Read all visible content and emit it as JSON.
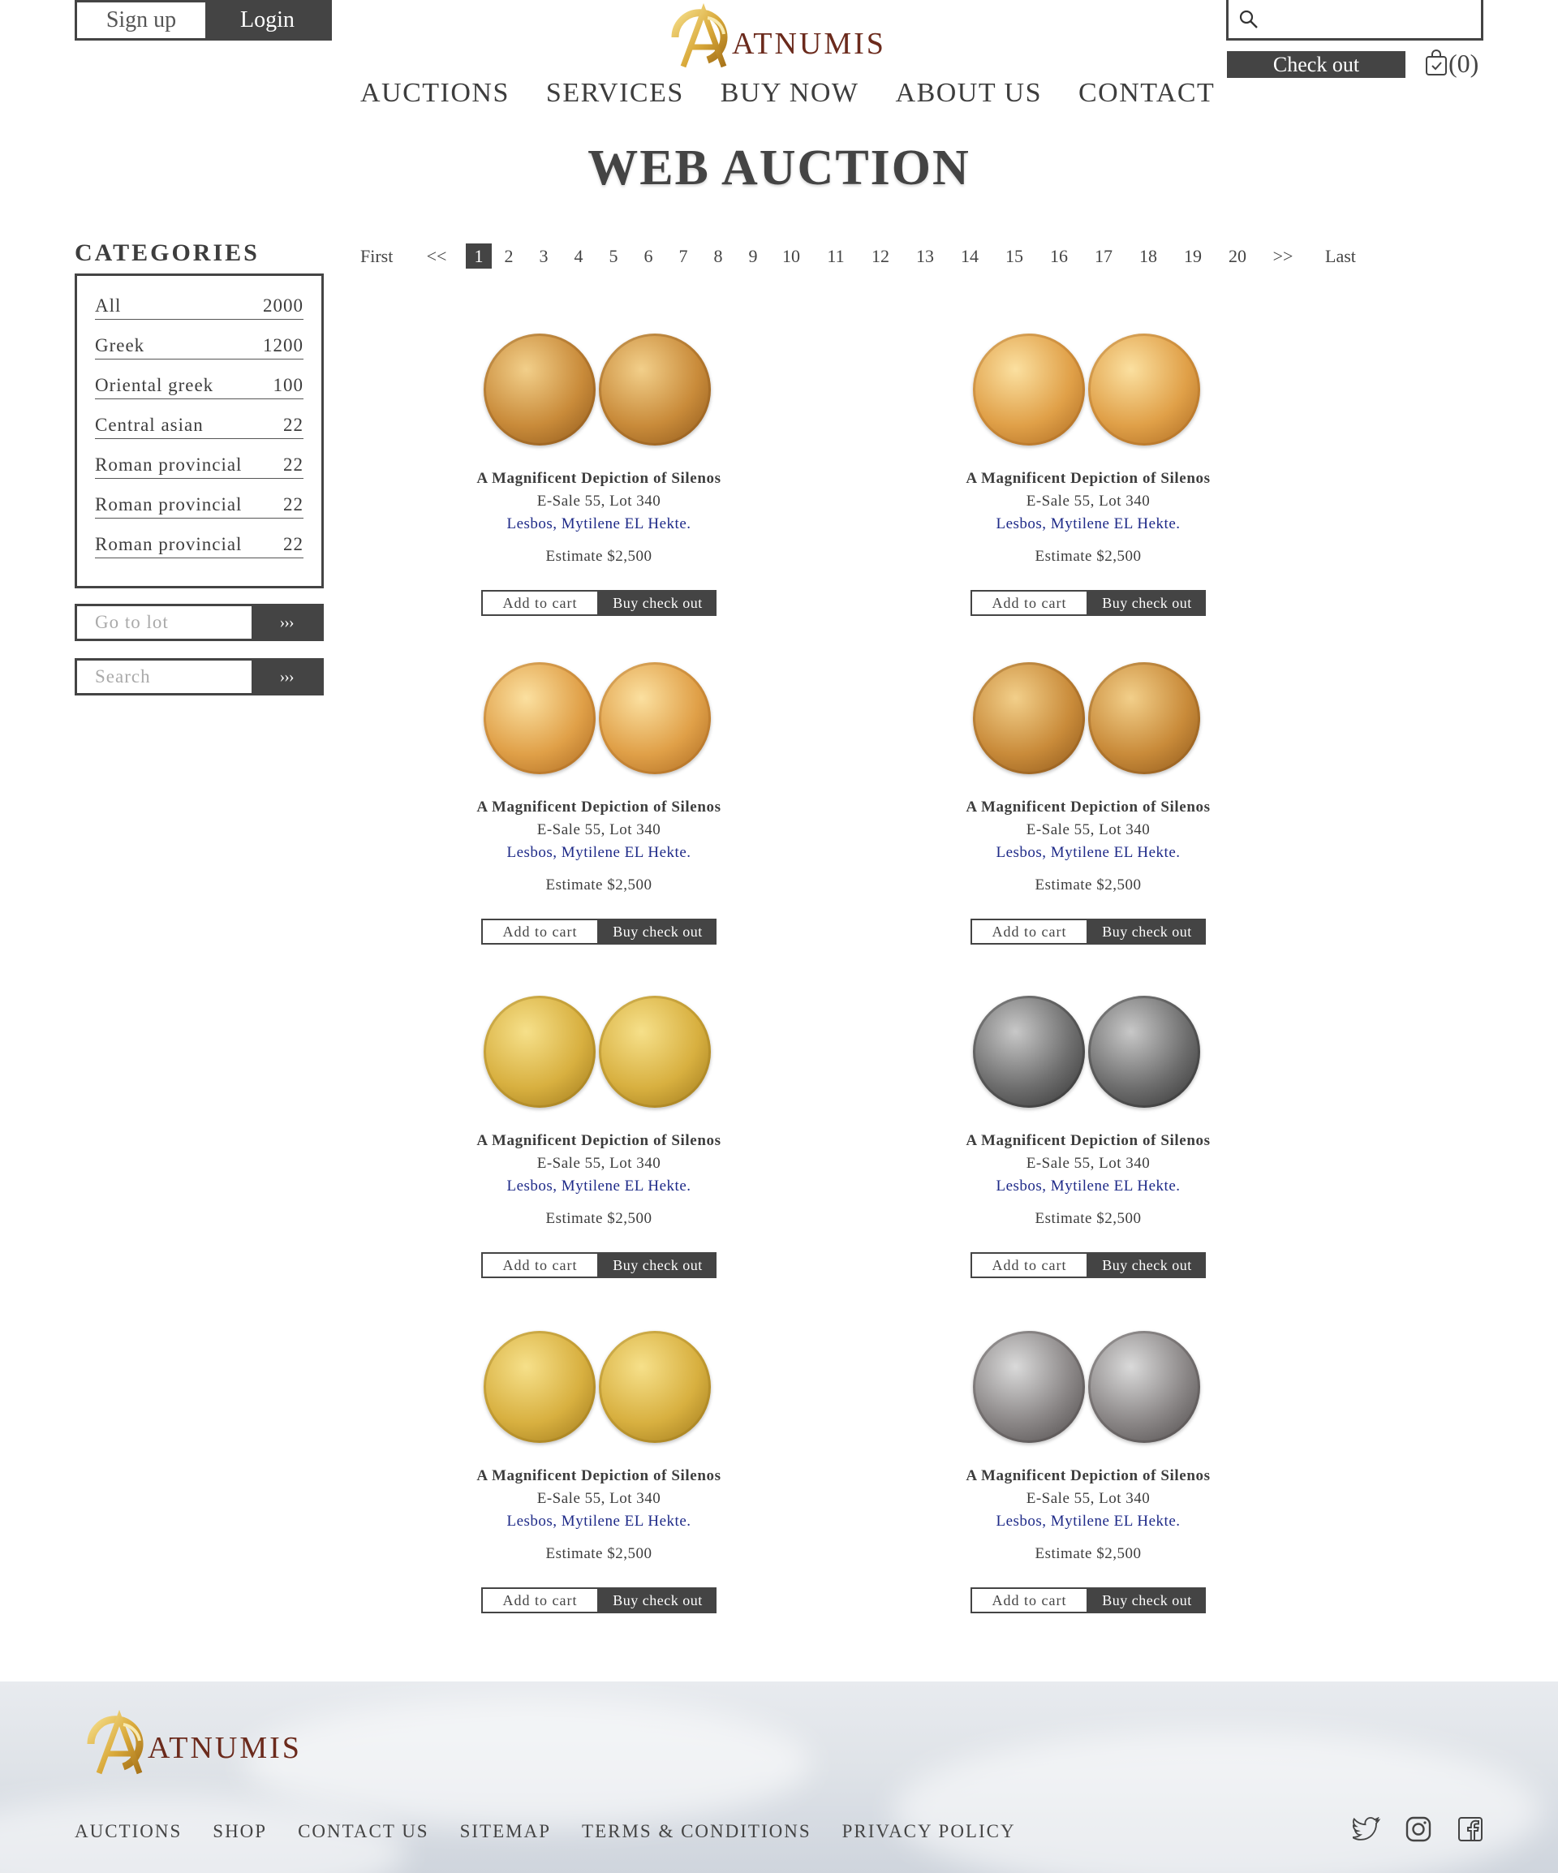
{
  "header": {
    "signup_label": "Sign up",
    "login_label": "Login",
    "logo_text": "ATNUMIS",
    "checkout_label": "Check out",
    "cart_count": "(0)"
  },
  "nav": [
    {
      "label": "AUCTIONS"
    },
    {
      "label": "SERVICES"
    },
    {
      "label": "BUY NOW"
    },
    {
      "label": "ABOUT US"
    },
    {
      "label": "CONTACT"
    }
  ],
  "page_title": "WEB AUCTION",
  "sidebar": {
    "title": "CATEGORIES",
    "categories": [
      {
        "name": "All",
        "count": "2000"
      },
      {
        "name": "Greek",
        "count": "1200"
      },
      {
        "name": "Oriental greek",
        "count": "100"
      },
      {
        "name": "Central asian",
        "count": "22"
      },
      {
        "name": "Roman provincial",
        "count": "22"
      },
      {
        "name": "Roman provincial",
        "count": "22"
      },
      {
        "name": "Roman provincial",
        "count": "22"
      }
    ],
    "goto_placeholder": "Go to lot",
    "search_placeholder": "Search",
    "go_label": "›››"
  },
  "pagination": {
    "first": "First",
    "prev": "<<",
    "pages": [
      "1",
      "2",
      "3",
      "4",
      "5",
      "6",
      "7",
      "8",
      "9",
      "10",
      "11",
      "12",
      "13",
      "14",
      "15",
      "16",
      "17",
      "18",
      "19",
      "20"
    ],
    "active": "1",
    "next": ">>",
    "last": "Last"
  },
  "products": [
    {
      "title": "A Magnificent Depiction of Silenos",
      "lot": "E-Sale 55, Lot 340",
      "desc": "Lesbos, Mytilene EL Hekte.",
      "estimate": "Estimate $2,500",
      "add_label": "Add to cart",
      "buy_label": "Buy check out",
      "metal": "gold"
    },
    {
      "title": "A Magnificent Depiction of Silenos",
      "lot": "E-Sale 55, Lot 340",
      "desc": "Lesbos, Mytilene EL Hekte.",
      "estimate": "Estimate $2,500",
      "add_label": "Add to cart",
      "buy_label": "Buy check out",
      "metal": "gold-bright"
    },
    {
      "title": "A Magnificent Depiction of Silenos",
      "lot": "E-Sale 55, Lot 340",
      "desc": "Lesbos, Mytilene EL Hekte.",
      "estimate": "Estimate $2,500",
      "add_label": "Add to cart",
      "buy_label": "Buy check out",
      "metal": "gold-bright"
    },
    {
      "title": "A Magnificent Depiction of Silenos",
      "lot": "E-Sale 55, Lot 340",
      "desc": "Lesbos, Mytilene EL Hekte.",
      "estimate": "Estimate $2,500",
      "add_label": "Add to cart",
      "buy_label": "Buy check out",
      "metal": "gold"
    },
    {
      "title": "A Magnificent Depiction of Silenos",
      "lot": "E-Sale 55, Lot 340",
      "desc": "Lesbos, Mytilene EL Hekte.",
      "estimate": "Estimate $2,500",
      "add_label": "Add to cart",
      "buy_label": "Buy check out",
      "metal": "gold-yellow"
    },
    {
      "title": "A Magnificent Depiction of Silenos",
      "lot": "E-Sale 55, Lot 340",
      "desc": "Lesbos, Mytilene EL Hekte.",
      "estimate": "Estimate $2,500",
      "add_label": "Add to cart",
      "buy_label": "Buy check out",
      "metal": "silver"
    },
    {
      "title": "A Magnificent Depiction of Silenos",
      "lot": "E-Sale 55, Lot 340",
      "desc": "Lesbos, Mytilene EL Hekte.",
      "estimate": "Estimate $2,500",
      "add_label": "Add to cart",
      "buy_label": "Buy check out",
      "metal": "gold-yellow"
    },
    {
      "title": "A Magnificent Depiction of Silenos",
      "lot": "E-Sale 55, Lot 340",
      "desc": "Lesbos, Mytilene EL Hekte.",
      "estimate": "Estimate $2,500",
      "add_label": "Add to cart",
      "buy_label": "Buy check out",
      "metal": "silver-light"
    }
  ],
  "footer": {
    "logo_text": "ATNUMIS",
    "links": [
      {
        "label": "AUCTIONS"
      },
      {
        "label": "SHOP"
      },
      {
        "label": "CONTACT US"
      },
      {
        "label": "SITEMAP"
      },
      {
        "label": "TERMS & CONDITIONS"
      },
      {
        "label": "PRIVACY POLICY"
      }
    ],
    "social_icons": [
      "twitter-icon",
      "instagram-icon",
      "facebook-icon"
    ]
  },
  "colors": {
    "dark": "#444444",
    "link_blue": "#1e2a88",
    "logo_brown": "#6b2a1c",
    "gold": "#c9942f"
  }
}
